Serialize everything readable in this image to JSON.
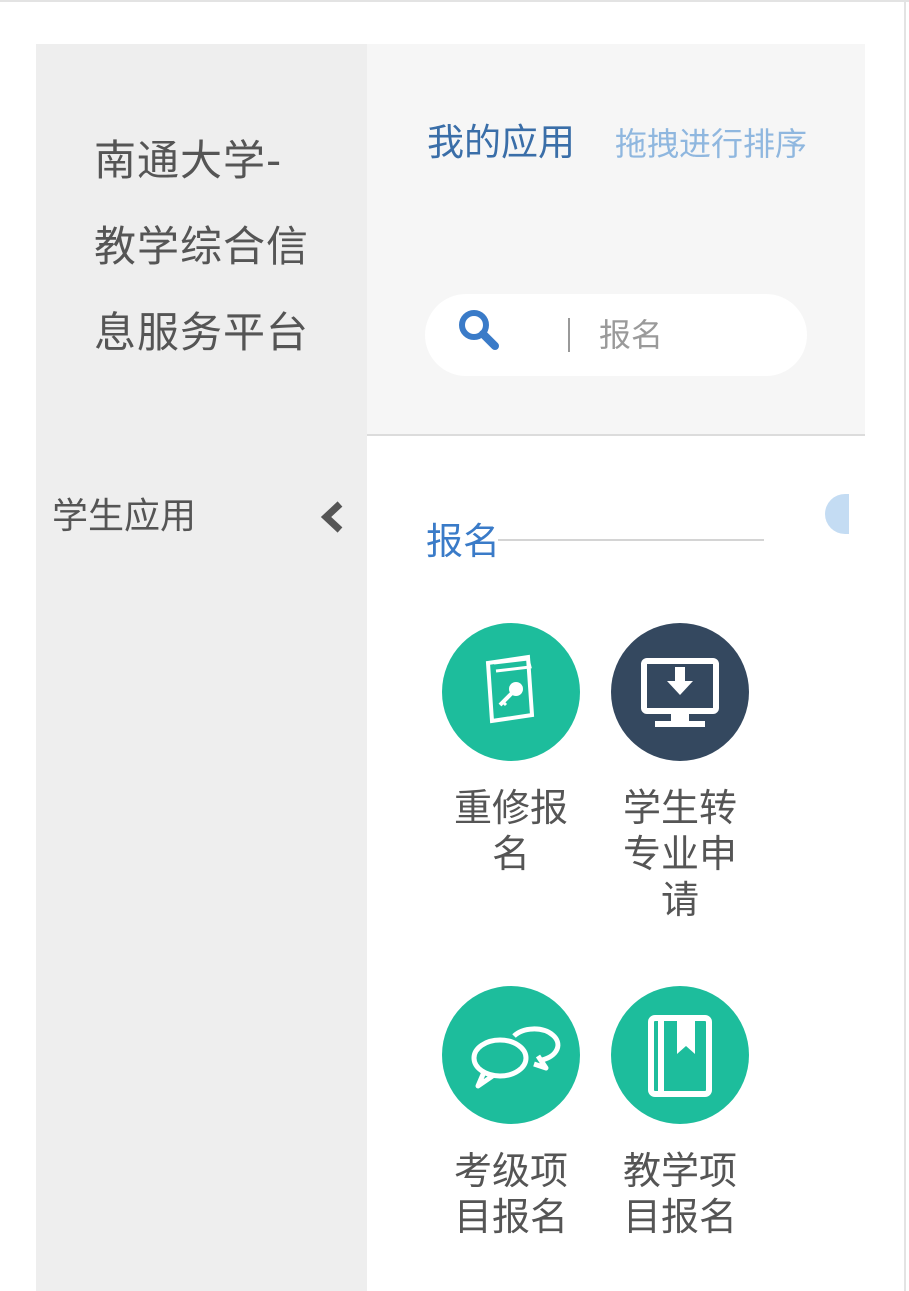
{
  "sidebar": {
    "title": "南通大学-教学综合信息服务平台",
    "section": "学生应用"
  },
  "header": {
    "title": "我的应用",
    "drag_hint": "拖拽进行排序"
  },
  "search": {
    "value": "",
    "placeholder": "报名"
  },
  "category": {
    "title": "报名"
  },
  "apps": [
    {
      "label": "重修报名",
      "icon": "book-key-icon",
      "color": "#1dbd9c"
    },
    {
      "label": "学生转专业申请",
      "icon": "monitor-download-icon",
      "color": "#34485f"
    },
    {
      "label": "考级项目报名",
      "icon": "speech-bubbles-icon",
      "color": "#1dbd9c"
    },
    {
      "label": "教学项目报名",
      "icon": "bookmark-book-icon",
      "color": "#1dbd9c"
    }
  ],
  "colors": {
    "sidebar_bg": "#eeeeee",
    "header_bg": "#f6f6f6",
    "accent_blue": "#3a7bc8",
    "teal": "#1dbd9c",
    "navy": "#34485f"
  }
}
